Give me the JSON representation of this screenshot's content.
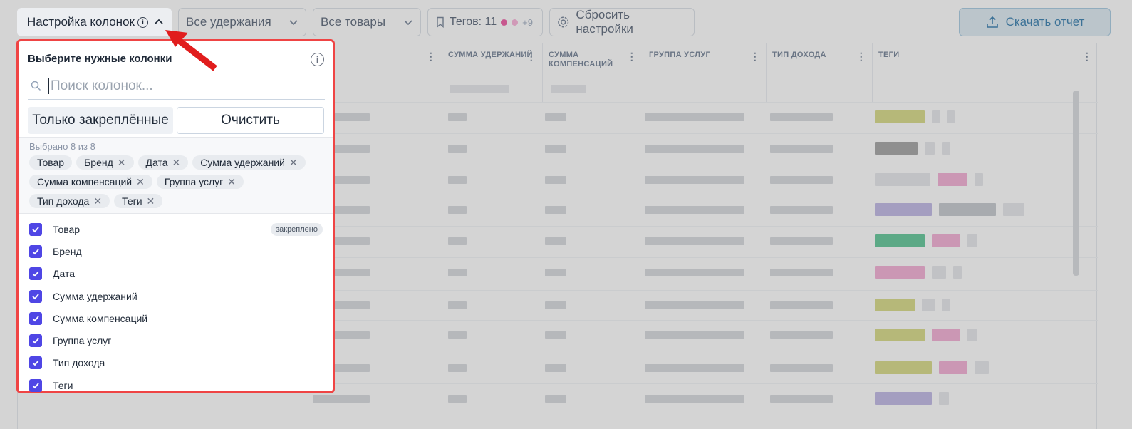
{
  "toolbar": {
    "column_settings_label": "Настройка колонок",
    "holds_label": "Все удержания",
    "goods_label": "Все товары",
    "tags_label": "Тегов: 11",
    "tags_extra": "+9",
    "reset_label": "Сбросить настройки",
    "download_label": "Скачать отчет"
  },
  "table": {
    "headers": [
      "Сумма удержаний",
      "Сумма компенсаций",
      "Группа услуг",
      "Тип дохода",
      "Теги"
    ]
  },
  "panel": {
    "title": "Выберите нужные колонки",
    "search_placeholder": "Поиск колонок...",
    "pinned_only_label": "Только закреплённые",
    "clear_label": "Очистить",
    "selected_count": "Выбрано 8 из 8",
    "chips": [
      "Товар",
      "Бренд",
      "Дата",
      "Сумма удержаний",
      "Сумма компенсаций",
      "Группа услуг",
      "Тип дохода",
      "Теги"
    ],
    "items": [
      {
        "label": "Товар",
        "badge": "закреплено"
      },
      {
        "label": "Бренд"
      },
      {
        "label": "Дата"
      },
      {
        "label": "Сумма удержаний"
      },
      {
        "label": "Сумма компенсаций"
      },
      {
        "label": "Группа услуг"
      },
      {
        "label": "Тип дохода"
      },
      {
        "label": "Теги"
      }
    ]
  },
  "colors": {
    "accent_checkbox": "#4f46e5",
    "highlight_border": "#ef4444",
    "download_text": "#1f6fa5"
  }
}
